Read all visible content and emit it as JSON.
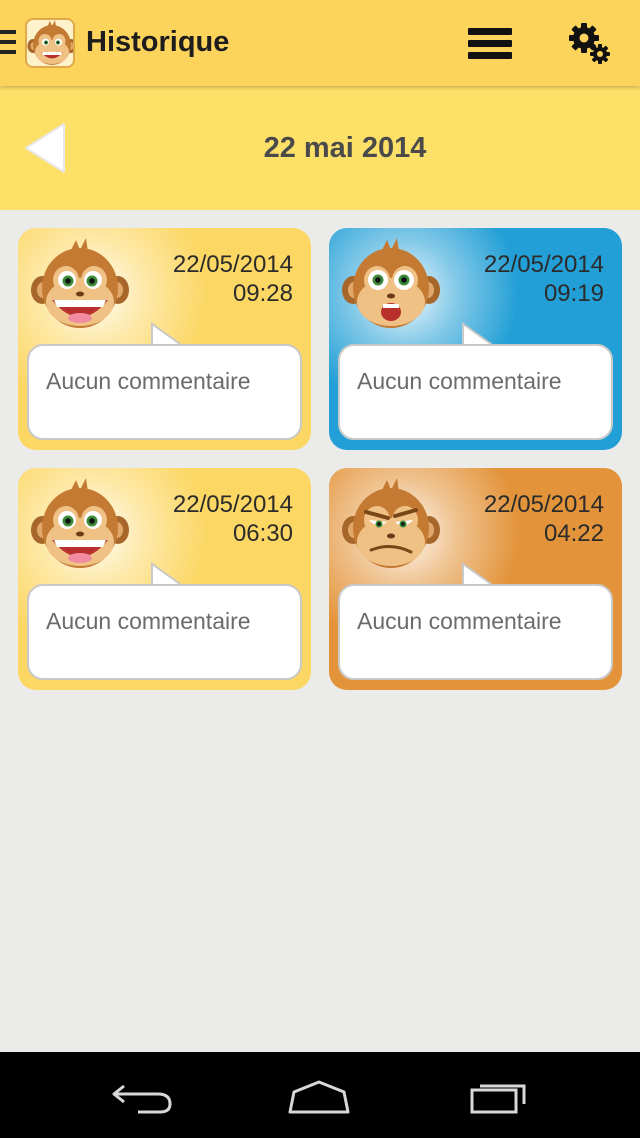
{
  "app": {
    "title": "Historique",
    "icon": "monkey-app-icon"
  },
  "toolbar": {
    "menu_icon": "menu-icon",
    "settings_icon": "gear-icon"
  },
  "datebar": {
    "date_label": "22 mai 2014",
    "back_icon": "back-arrow-icon"
  },
  "entries": [
    {
      "date": "22/05/2014",
      "time": "09:28",
      "comment": "Aucun commentaire",
      "mood": "happy",
      "color": "#fcd763"
    },
    {
      "date": "22/05/2014",
      "time": "09:19",
      "comment": "Aucun commentaire",
      "mood": "surprised",
      "color": "#229fd6"
    },
    {
      "date": "22/05/2014",
      "time": "06:30",
      "comment": "Aucun commentaire",
      "mood": "happy",
      "color": "#fcd763"
    },
    {
      "date": "22/05/2014",
      "time": "04:22",
      "comment": "Aucun commentaire",
      "mood": "grumpy",
      "color": "#e3943a"
    }
  ],
  "navbar": {
    "back_icon": "nav-back-icon",
    "home_icon": "nav-home-icon",
    "recents_icon": "nav-recents-icon"
  },
  "colors": {
    "actionbar": "#fcd45c",
    "datebar": "#fde068",
    "background": "#ebebea"
  }
}
